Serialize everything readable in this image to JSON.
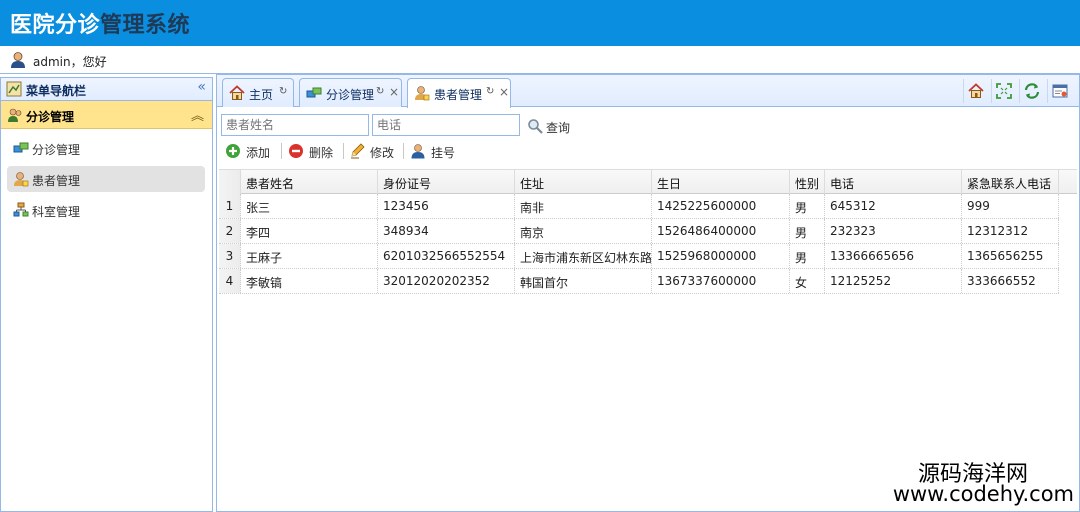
{
  "header": {
    "title_part1": "医院分诊",
    "title_part2": "管理系统"
  },
  "userbar": {
    "greeting": "admin，您好"
  },
  "sidebar": {
    "title": "菜单导航栏",
    "section": {
      "title": "分诊管理"
    },
    "items": [
      {
        "label": "分诊管理"
      },
      {
        "label": "患者管理"
      },
      {
        "label": "科室管理"
      }
    ]
  },
  "tabs": [
    {
      "label": "主页"
    },
    {
      "label": "分诊管理"
    },
    {
      "label": "患者管理"
    }
  ],
  "search": {
    "name_placeholder": "患者姓名",
    "phone_placeholder": "电话",
    "query_label": "查询"
  },
  "toolbar": {
    "add_label": "添加",
    "delete_label": "删除",
    "edit_label": "修改",
    "register_label": "挂号"
  },
  "table": {
    "columns": [
      "患者姓名",
      "身份证号",
      "住址",
      "生日",
      "性别",
      "电话",
      "紧急联系人电话"
    ],
    "rows": [
      {
        "num": "1",
        "cells": [
          "张三",
          "123456",
          "南非",
          "1425225600000",
          "男",
          "645312",
          "999"
        ]
      },
      {
        "num": "2",
        "cells": [
          "李四",
          "348934",
          "南京",
          "1526486400000",
          "男",
          "232323",
          "12312312"
        ]
      },
      {
        "num": "3",
        "cells": [
          "王麻子",
          "6201032566552554",
          "上海市浦东新区幻林东路",
          "1525968000000",
          "男",
          "13366665656",
          "1365656255"
        ]
      },
      {
        "num": "4",
        "cells": [
          "李敏镐",
          "32012020202352",
          "韩国首尔",
          "1367337600000",
          "女",
          "12125252",
          "333666552"
        ]
      }
    ]
  },
  "watermark": {
    "line1": "源码海洋网",
    "line2": "www.codehy.com"
  }
}
